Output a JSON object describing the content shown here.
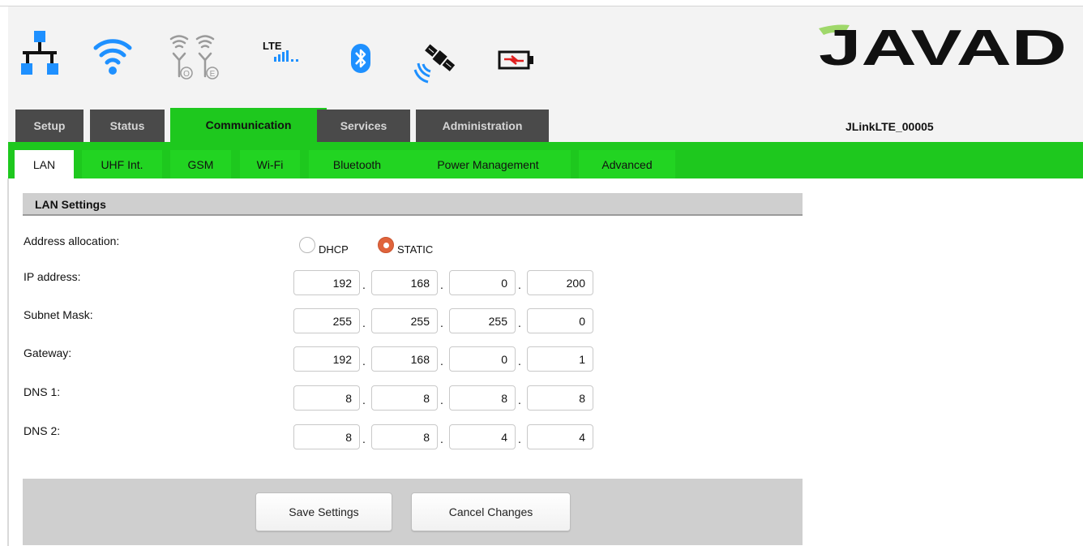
{
  "status_icons": [
    "lan-icon",
    "wifi-icon",
    "uhf-radio-icon",
    "lte-signal-icon",
    "bluetooth-icon",
    "satellite-icon",
    "battery-icon"
  ],
  "lte_label": "LTE",
  "uhf_sub_a": "O",
  "uhf_sub_b": "E",
  "brand": "JAVAD",
  "colors": {
    "accent_green": "#1ec81e",
    "tab_dark": "#4a4a4a",
    "radio_checked": "#e0643c",
    "wifi_blue": "#1e90ff",
    "battery_red": "#e02020"
  },
  "main_tabs": [
    {
      "label": "Setup"
    },
    {
      "label": "Status"
    },
    {
      "label": "Communication"
    },
    {
      "label": "Services"
    },
    {
      "label": "Administration"
    }
  ],
  "device_name": "JLinkLTE_00005",
  "sub_tabs": [
    {
      "label": "LAN"
    },
    {
      "label": "UHF Int."
    },
    {
      "label": "GSM"
    },
    {
      "label": "Wi-Fi"
    },
    {
      "label": "Bluetooth"
    },
    {
      "label": "Power Management"
    },
    {
      "label": "Advanced"
    }
  ],
  "section_title": "LAN Settings",
  "address_allocation": {
    "label": "Address allocation:",
    "options": [
      {
        "label": "DHCP",
        "checked": false
      },
      {
        "label": "STATIC",
        "checked": true
      }
    ]
  },
  "fields": [
    {
      "label": "IP address:",
      "octets": [
        "192",
        "168",
        "0",
        "200"
      ]
    },
    {
      "label": "Subnet Mask:",
      "octets": [
        "255",
        "255",
        "255",
        "0"
      ]
    },
    {
      "label": "Gateway:",
      "octets": [
        "192",
        "168",
        "0",
        "1"
      ]
    },
    {
      "label": "DNS 1:",
      "octets": [
        "8",
        "8",
        "8",
        "8"
      ]
    },
    {
      "label": "DNS 2:",
      "octets": [
        "8",
        "8",
        "4",
        "4"
      ]
    }
  ],
  "dot_char": ".",
  "buttons": {
    "save": "Save Settings",
    "cancel": "Cancel Changes"
  }
}
